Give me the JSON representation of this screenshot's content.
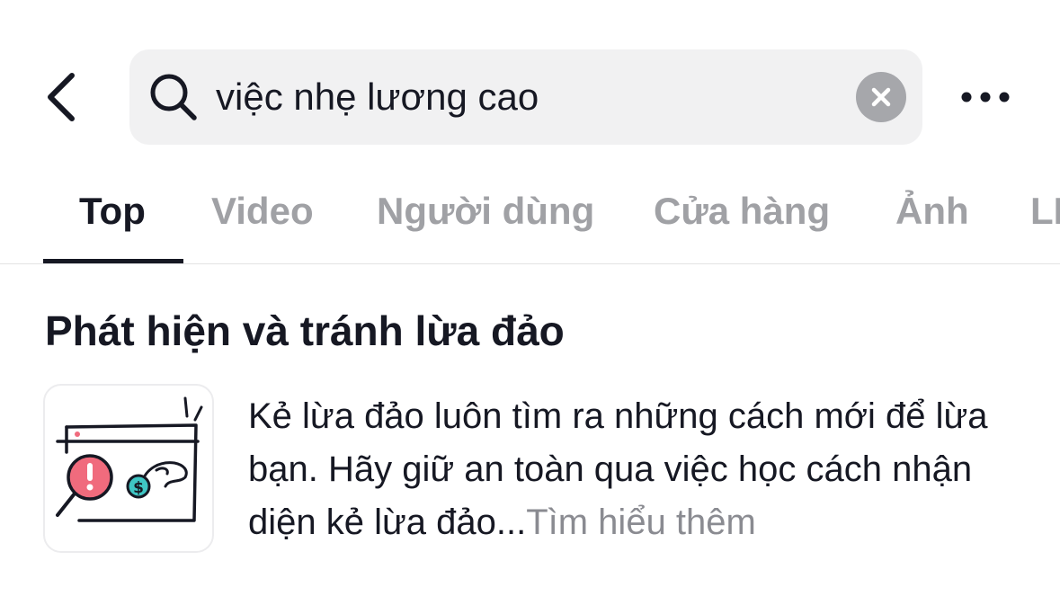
{
  "search": {
    "query": "việc nhẹ lương cao"
  },
  "icons": {
    "back": "chevron-left-icon",
    "search": "magnifier-icon",
    "clear": "x-circle-icon",
    "more": "ellipsis-icon"
  },
  "tabs": [
    {
      "label": "Top",
      "active": true
    },
    {
      "label": "Video",
      "active": false
    },
    {
      "label": "Người dùng",
      "active": false
    },
    {
      "label": "Cửa hàng",
      "active": false
    },
    {
      "label": "Ảnh",
      "active": false
    },
    {
      "label": "LI",
      "active": false
    }
  ],
  "scam_card": {
    "title": "Phát hiện và tránh lừa đảo",
    "description": "Kẻ lừa đảo luôn tìm ra những cách mới để lừa bạn. Hãy giữ an toàn qua việc học cách nhận diện kẻ lừa đảo...",
    "learn_more": "Tìm hiểu thêm"
  },
  "colors": {
    "text_primary": "#161823",
    "text_inactive": "#a0a1a5",
    "search_bg": "#f1f1f2",
    "clear_bg": "#a6a7ab",
    "alert_red": "#f06b7d",
    "money_teal": "#3fc6c4"
  }
}
